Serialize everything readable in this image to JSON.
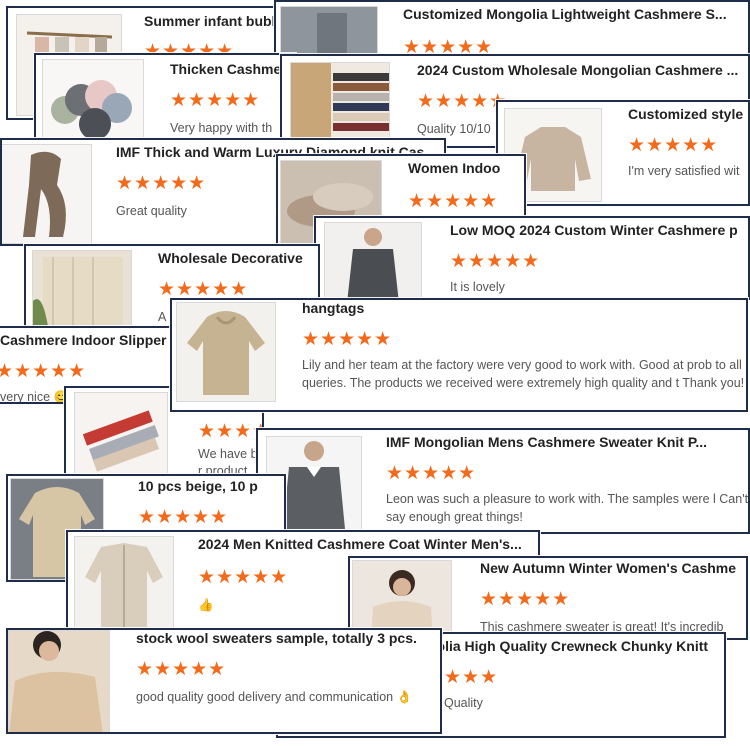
{
  "cards": [
    {
      "title": "Summer infant bubble",
      "stars": "★★★★★",
      "review": ""
    },
    {
      "title": "Customized Mongolia Lightweight Cashmere S...",
      "stars": "★★★★★",
      "review": ""
    },
    {
      "title": "Thicken Cashme",
      "stars": "★★★★★",
      "review": "Very happy with th"
    },
    {
      "title": "2024 Custom Wholesale Mongolian Cashmere ...",
      "stars": "★★★★★",
      "review": "Quality 10/10"
    },
    {
      "title": "Customized style",
      "stars": "★★★★★",
      "review": "I'm very satisfied wit"
    },
    {
      "title": "IMF Thick and Warm Luxury Diamond knit Cas",
      "stars": "★★★★★",
      "review": "Great quality"
    },
    {
      "title": "Women Indoo",
      "stars": "★★★★★",
      "review": ""
    },
    {
      "title": "Low MOQ 2024 Custom Winter Cashmere p",
      "stars": "★★★★★",
      "review": "It is lovely"
    },
    {
      "title": "Wholesale Decorative",
      "stars": "★★★★★",
      "review": "A"
    },
    {
      "title": "Cashmere Indoor Slipper",
      "stars": "★★★★★",
      "review": "very nice 😊"
    },
    {
      "title": "hangtags",
      "stars": "★★★★★",
      "review": "Lily and her team at the factory were very good to work with. Good at prob to all queries. The products we received were extremely high quality and t Thank you!"
    },
    {
      "title": "",
      "stars": "★★★★",
      "review": "We have b r product"
    },
    {
      "title": "IMF Mongolian Mens Cashmere Sweater Knit P...",
      "stars": "★★★★★",
      "review": "Leon was such a pleasure to work with. The samples were l Can't say enough great things!"
    },
    {
      "title": "10 pcs beige, 10 p",
      "stars": "★★★★★",
      "review": ""
    },
    {
      "title": "2024 Men Knitted Cashmere Coat Winter Men's...",
      "stars": "★★★★★",
      "review": "👍"
    },
    {
      "title": "New Autumn Winter Women's Cashme",
      "stars": "★★★★★",
      "review": "This cashmere sweater is great! It's incredib"
    },
    {
      "title": "golia High Quality Crewneck Chunky Knitt",
      "stars": "★★★",
      "review": "Quality"
    },
    {
      "title": "stock wool sweaters sample, totally 3 pcs.",
      "stars": "★★★★★",
      "review": "good quality good delivery and communication 👌"
    }
  ]
}
